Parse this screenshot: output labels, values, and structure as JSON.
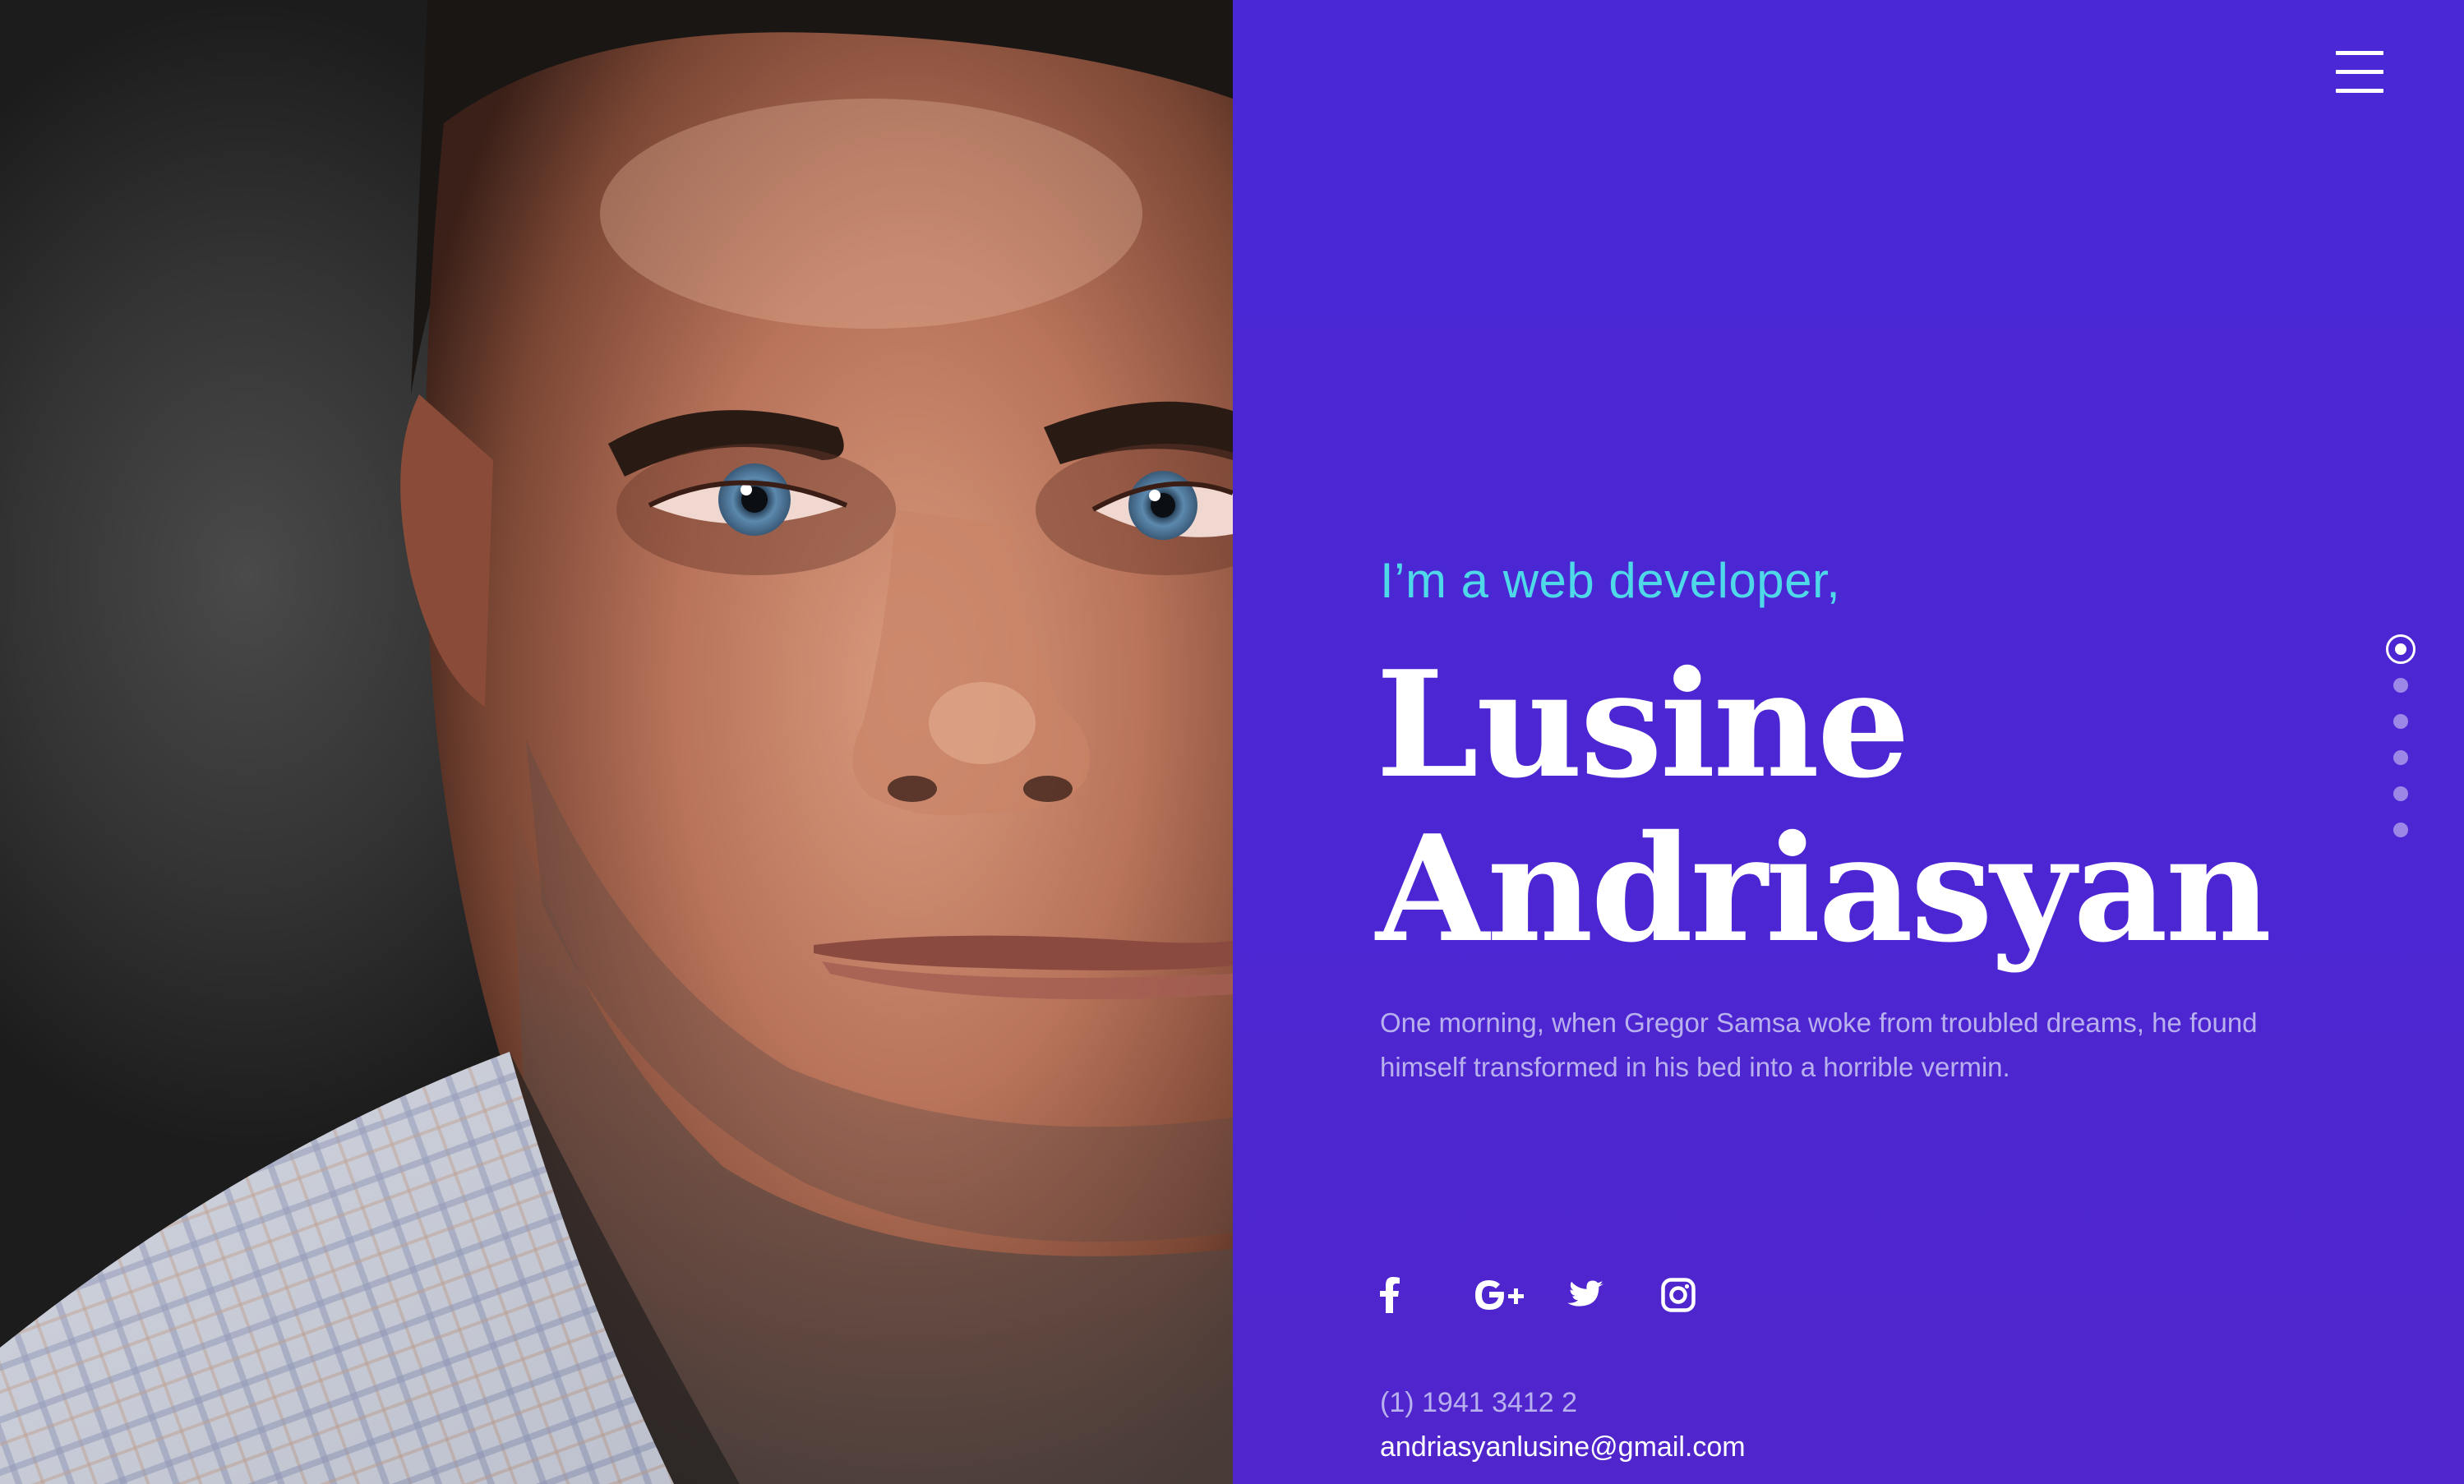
{
  "hero": {
    "intro": "I’m a web developer,",
    "name_line1": "Lusine",
    "name_line2": "Andriasyan",
    "bio": "One morning, when Gregor Samsa woke from troubled dreams, he found himself transformed in his bed into a horrible vermin."
  },
  "contact": {
    "phone": "(1) 1941 3412 2",
    "email": "andriasyanlusine@gmail.com"
  },
  "social": [
    {
      "icon": "facebook-icon"
    },
    {
      "icon": "google-plus-icon"
    },
    {
      "icon": "twitter-icon"
    },
    {
      "icon": "instagram-icon"
    }
  ],
  "section_nav": {
    "count": 6,
    "active_index": 0
  },
  "colors": {
    "panel": "#4a28d6",
    "accent": "#4fd8e8",
    "text_primary": "#ffffff",
    "text_muted": "#b9b0ee"
  }
}
